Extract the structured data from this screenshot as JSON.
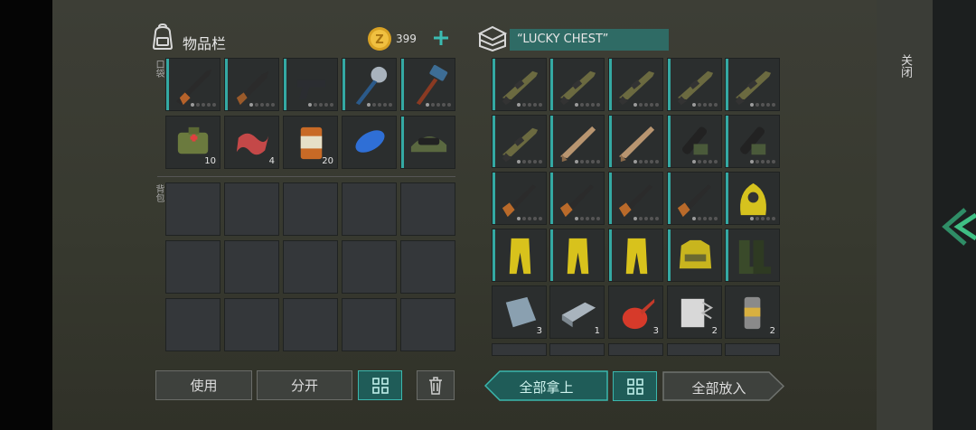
{
  "inventory": {
    "title": "物品栏",
    "coins": "399",
    "pocket_label": "口袋",
    "backpack_label": "背包",
    "pocket_row1": [
      {
        "icon": "shotgun-icon",
        "qty": ""
      },
      {
        "icon": "sawed-off-shotgun-icon",
        "qty": ""
      },
      {
        "icon": "pistol-icon",
        "qty": ""
      },
      {
        "icon": "spiked-club-icon",
        "qty": ""
      },
      {
        "icon": "sledgehammer-icon",
        "qty": ""
      }
    ],
    "pocket_row2": [
      {
        "icon": "first-aid-bag-icon",
        "qty": "10"
      },
      {
        "icon": "bacon-icon",
        "qty": "4"
      },
      {
        "icon": "canned-food-icon",
        "qty": "20"
      },
      {
        "icon": "blue-balloon-icon",
        "qty": ""
      },
      {
        "icon": "military-cap-icon",
        "qty": ""
      }
    ]
  },
  "chest": {
    "title": "“LUCKY CHEST”",
    "rows": [
      [
        {
          "icon": "assault-rifle-icon",
          "qty": ""
        },
        {
          "icon": "assault-rifle-icon",
          "qty": ""
        },
        {
          "icon": "assault-rifle-icon",
          "qty": ""
        },
        {
          "icon": "assault-rifle-icon",
          "qty": ""
        },
        {
          "icon": "assault-rifle-icon",
          "qty": ""
        }
      ],
      [
        {
          "icon": "assault-rifle-icon",
          "qty": ""
        },
        {
          "icon": "tan-rifle-icon",
          "qty": ""
        },
        {
          "icon": "tan-rifle-icon",
          "qty": ""
        },
        {
          "icon": "minigun-icon",
          "qty": ""
        },
        {
          "icon": "minigun-icon",
          "qty": ""
        }
      ],
      [
        {
          "icon": "hunting-rifle-icon",
          "qty": ""
        },
        {
          "icon": "hunting-rifle-icon",
          "qty": ""
        },
        {
          "icon": "hunting-rifle-icon",
          "qty": ""
        },
        {
          "icon": "hunting-rifle-icon",
          "qty": ""
        },
        {
          "icon": "hazmat-hood-icon",
          "qty": ""
        }
      ],
      [
        {
          "icon": "hazmat-pants-icon",
          "qty": ""
        },
        {
          "icon": "hazmat-pants-icon",
          "qty": ""
        },
        {
          "icon": "hazmat-pants-icon",
          "qty": ""
        },
        {
          "icon": "hazmat-jacket-icon",
          "qty": ""
        },
        {
          "icon": "rubber-boots-icon",
          "qty": ""
        }
      ],
      [
        {
          "icon": "metal-plate-icon",
          "qty": "3"
        },
        {
          "icon": "steel-ingot-icon",
          "qty": "1"
        },
        {
          "icon": "oil-can-icon",
          "qty": "3"
        },
        {
          "icon": "sandpaper-icon",
          "qty": "2"
        },
        {
          "icon": "spring-part-icon",
          "qty": "2"
        }
      ]
    ]
  },
  "buttons": {
    "use": "使用",
    "split": "分开",
    "take_all": "全部拿上",
    "put_all": "全部放入",
    "close": "关闭"
  },
  "colors": {
    "accent_teal": "#34a9a3",
    "background": "#3a3b33",
    "slot": "#2b2e2e"
  }
}
